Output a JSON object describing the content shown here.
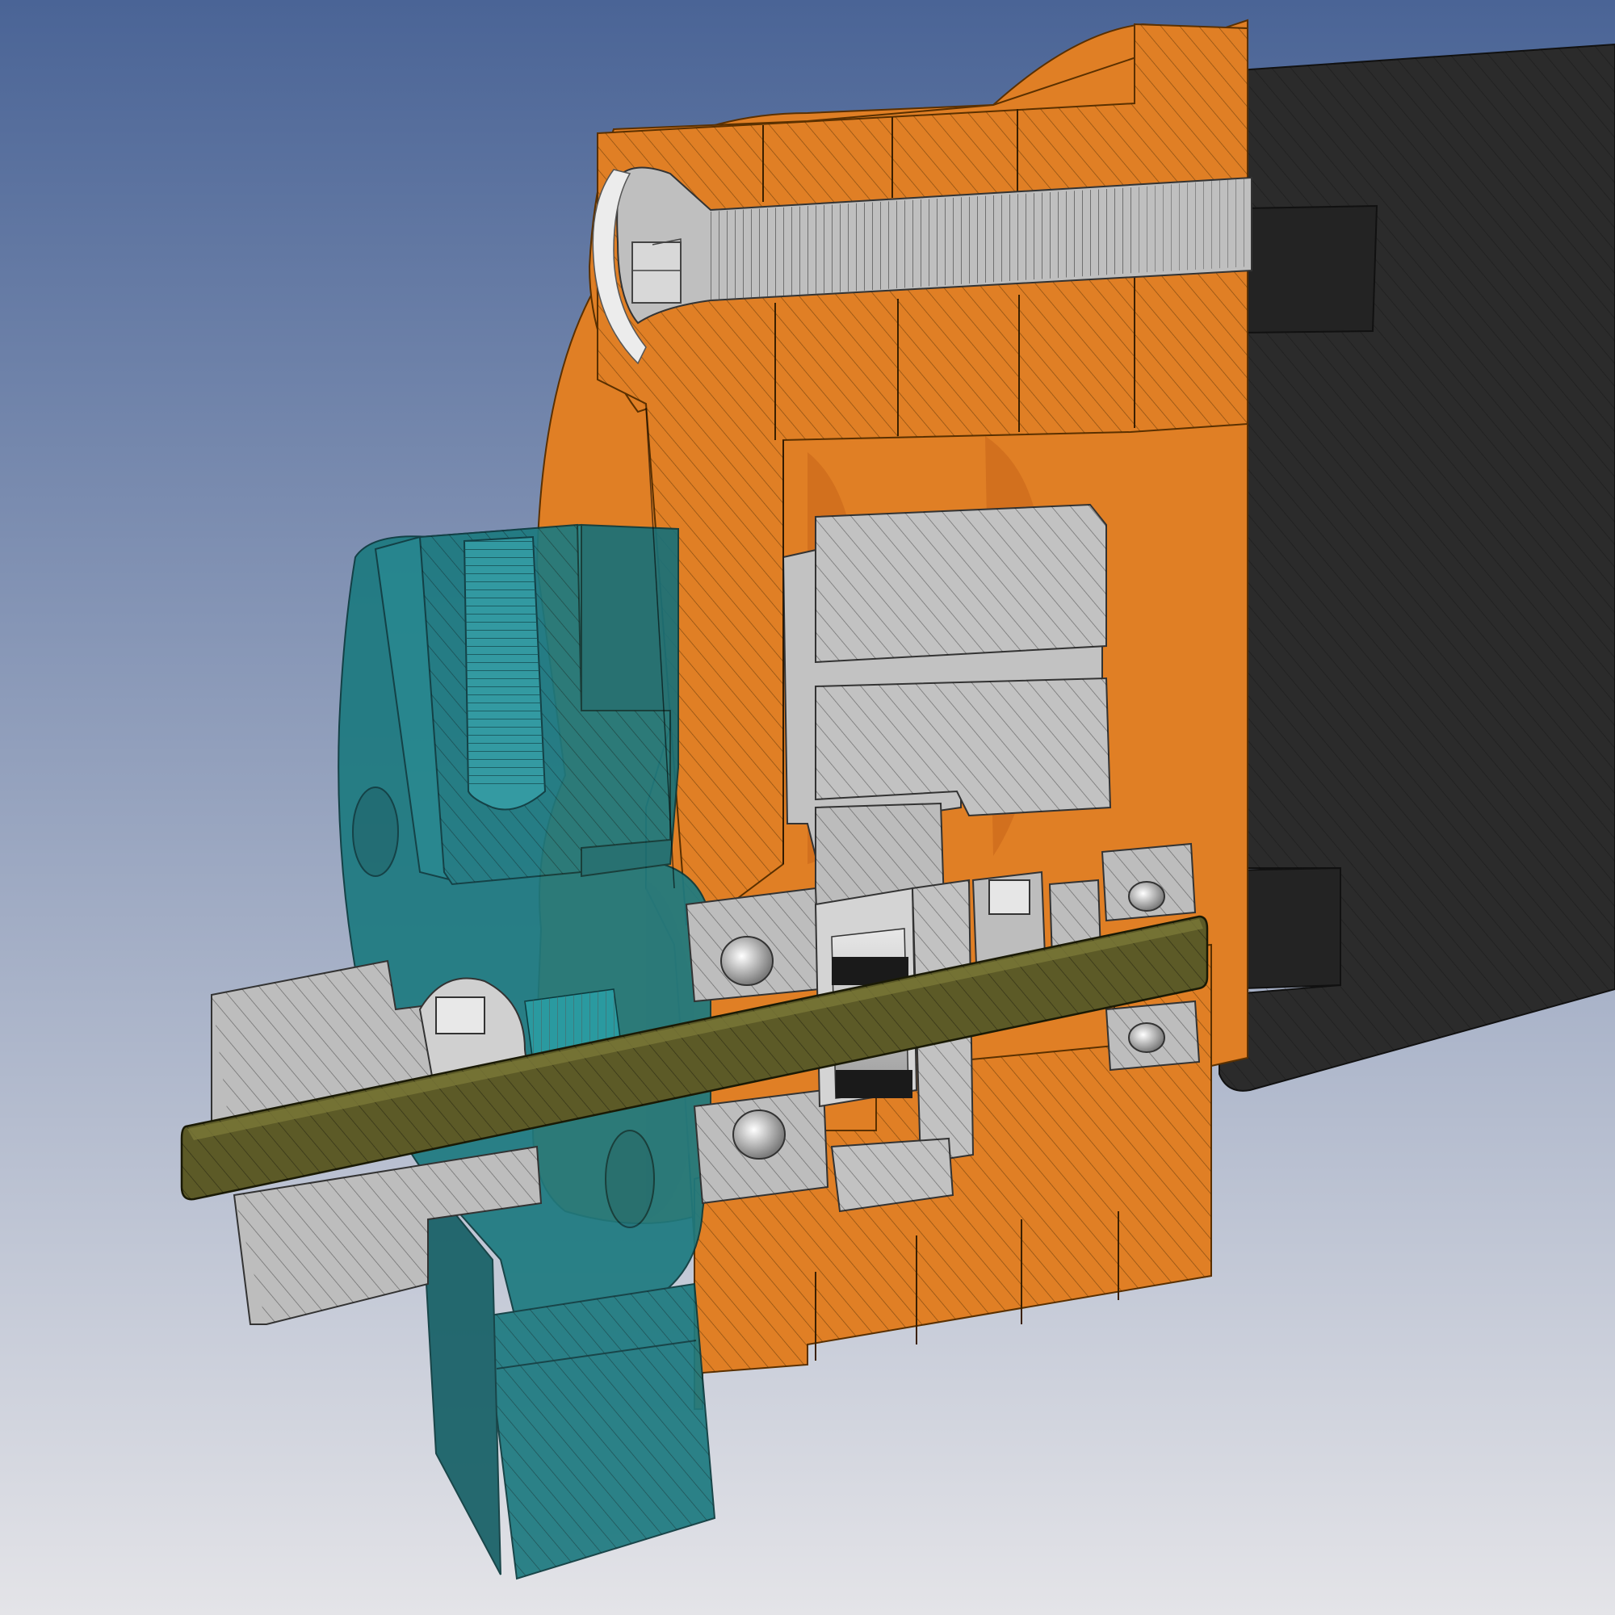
{
  "viewport": {
    "background_top": "#4a6496",
    "background_bottom": "#e4e4e8"
  },
  "parts": {
    "housing": {
      "color": "#e07f25",
      "dark": "#b95f12",
      "section": "hatched"
    },
    "motor_body": {
      "color": "#2b2b2b"
    },
    "adapter_block": {
      "color": "#1d7a80",
      "opacity": 0.85
    },
    "shaft": {
      "color": "#5c5a27"
    },
    "metal_parts": {
      "color": "#c2c2c2",
      "dark": "#8a8a8a"
    },
    "bearings": {
      "count": 4
    },
    "screws": {
      "count": 4
    }
  },
  "icons": [
    "hatch-pattern",
    "hex-socket-icon",
    "bearing-ball-icon"
  ]
}
